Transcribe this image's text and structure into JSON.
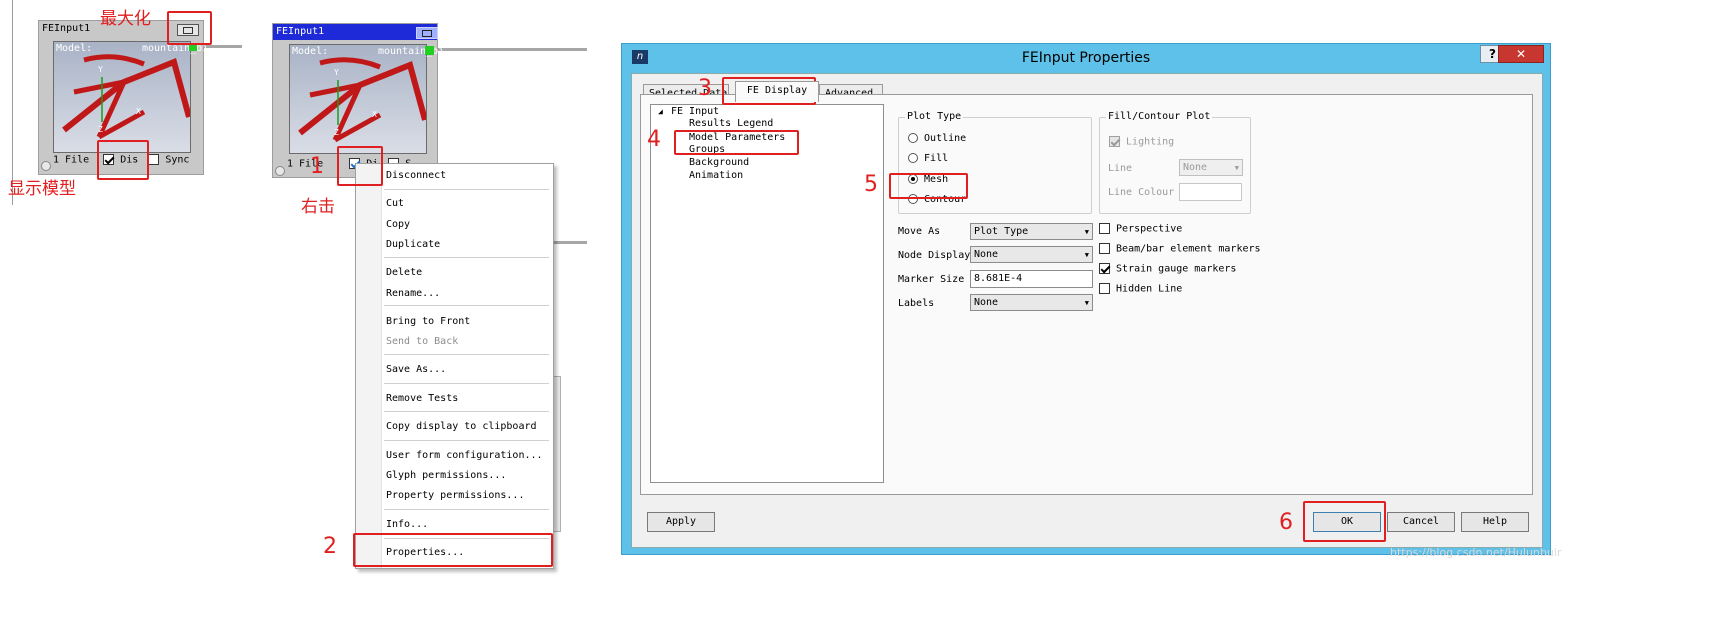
{
  "annotations": {
    "maximize": "最大化",
    "show_model": "显示模型",
    "right_click": "右击",
    "step1": "1",
    "step2": "2",
    "step3": "3",
    "step4": "4",
    "step5": "5",
    "step6": "6"
  },
  "glyph_left": {
    "title": "FEInput1",
    "model_label": "Model:",
    "model_value": "mountain_bi",
    "files": "1 File",
    "display_label": "Dis",
    "sync_label": "Sync"
  },
  "glyph_right": {
    "title": "FEInput1",
    "model_label": "Model:",
    "model_value": "mountain_bi",
    "files": "1 File",
    "display_label": "Di",
    "sync_label": "S"
  },
  "context_menu": {
    "disconnect": "Disconnect",
    "cut": "Cut",
    "copy": "Copy",
    "duplicate": "Duplicate",
    "delete": "Delete",
    "rename": "Rename...",
    "bring_to_front": "Bring to Front",
    "send_to_back": "Send to Back",
    "save_as": "Save As...",
    "remove_tests": "Remove Tests",
    "copy_display": "Copy display to clipboard",
    "user_form": "User form configuration...",
    "glyph_permissions": "Glyph permissions...",
    "property_permissions": "Property permissions...",
    "info": "Info...",
    "properties": "Properties..."
  },
  "dialog": {
    "title": "FEInput Properties",
    "help_btn": "?",
    "close_btn": "✕",
    "tabs": {
      "selected_data": "Selected Data",
      "fe_display": "FE Display",
      "advanced": "Advanced"
    },
    "tree": {
      "root": "FE Input",
      "results_legend": "Results Legend",
      "model_parameters": "Model Parameters",
      "groups": "Groups",
      "background": "Background",
      "animation": "Animation"
    },
    "plot_type": {
      "title": "Plot Type",
      "outline": "Outline",
      "fill": "Fill",
      "mesh": "Mesh",
      "contour": "Contour",
      "selected": "Mesh"
    },
    "fill_contour": {
      "title": "Fill/Contour Plot",
      "lighting": "Lighting",
      "line_label": "Line",
      "line_value": "None",
      "line_colour_label": "Line Colour"
    },
    "fields": {
      "move_as_label": "Move As",
      "move_as_value": "Plot Type",
      "node_display_label": "Node Display",
      "node_display_value": "None",
      "marker_size_label": "Marker Size",
      "marker_size_value": "8.681E-4",
      "labels_label": "Labels",
      "labels_value": "None"
    },
    "options": {
      "perspective": "Perspective",
      "beam_bar": "Beam/bar element markers",
      "strain_gauge": "Strain gauge markers",
      "hidden_line": "Hidden Line"
    },
    "buttons": {
      "apply": "Apply",
      "ok": "OK",
      "cancel": "Cancel",
      "help": "Help"
    }
  },
  "watermark": "https://blog.csdn.net/Hulunbuir"
}
